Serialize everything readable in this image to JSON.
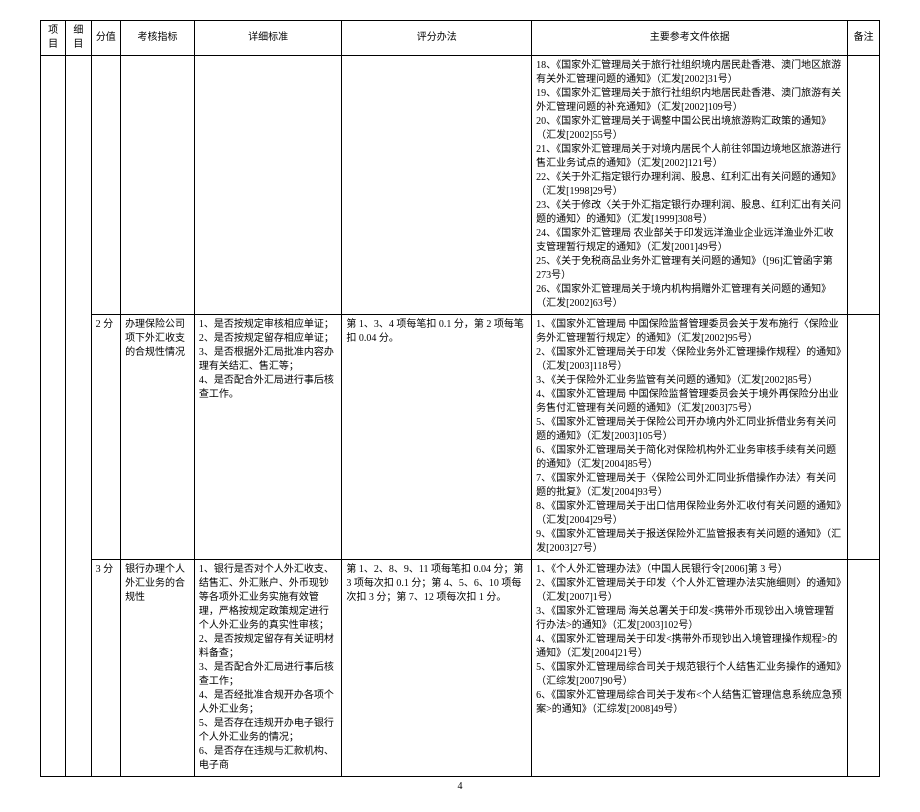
{
  "headers": {
    "project": "项目",
    "detail": "细目",
    "score": "分值",
    "index": "考核指标",
    "standard": "详细标准",
    "method": "评分办法",
    "reference": "主要参考文件依据",
    "note": "备注"
  },
  "rows": [
    {
      "score": "",
      "index": "",
      "standard": "",
      "method": "",
      "reference": "18、《国家外汇管理局关于旅行社组织境内居民赴香港、澳门地区旅游有关外汇管理问题的通知》（汇发[2002]31号）\n19、《国家外汇管理局关于旅行社组织内地居民赴香港、澳门旅游有关外汇管理问题的补充通知》（汇发[2002]109号）\n20、《国家外汇管理局关于调整中国公民出境旅游购汇政策的通知》（汇发[2002]55号）\n21、《国家外汇管理局关于对境内居民个人前往邻国边境地区旅游进行售汇业务试点的通知》（汇发[2002]121号）\n22、《关于外汇指定银行办理利润、股息、红利汇出有关问题的通知》（汇发[1998]29号）\n23、《关于修改〈关于外汇指定银行办理利润、股息、红利汇出有关问题的通知〉的通知》（汇发[1999]308号）\n24、《国家外汇管理局 农业部关于印发远洋渔业企业远洋渔业外汇收支管理暂行规定的通知》（汇发[2001]49号）\n25、《关于免税商品业务外汇管理有关问题的通知》（[96]汇管函字第273号）\n26、《国家外汇管理局关于境内机构捐赠外汇管理有关问题的通知》（汇发[2002]63号）",
      "note": ""
    },
    {
      "score": "2 分",
      "index": "办理保险公司项下外汇收支的合规性情况",
      "standard": "1、是否按规定审核相应单证；\n2、是否按规定留存相应单证；\n3、是否根据外汇局批准内容办理有关结汇、售汇等；\n4、是否配合外汇局进行事后核查工作。",
      "method": "第 1、3、4 项每笔扣 0.1 分，第 2 项每笔扣 0.04 分。",
      "reference": "1、《国家外汇管理局 中国保险监督管理委员会关于发布施行〈保险业务外汇管理暂行规定〉的通知》（汇发[2002]95号）\n2、《国家外汇管理局关于印发〈保险业务外汇管理操作规程〉的通知》（汇发[2003]118号）\n3、《关于保险外汇业务监管有关问题的通知》（汇发[2002]85号）\n4、《国家外汇管理局 中国保险监督管理委员会关于境外再保险分出业务售付汇管理有关问题的通知》（汇发[2003]75号）\n5、《国家外汇管理局关于保险公司开办境内外汇同业拆借业务有关问题的通知》（汇发[2003]105号）\n6、《国家外汇管理局关于简化对保险机构外汇业务审核手续有关问题的通知》（汇发[2004]85号）\n7、《国家外汇管理局关于〈保险公司外汇同业拆借操作办法〉有关问题的批复》（汇发[2004]93号）\n8、《国家外汇管理局关于出口信用保险业务外汇收付有关问题的通知》（汇发[2004]29号）\n9、《国家外汇管理局关于报送保险外汇监管报表有关问题的通知》（汇发[2003]27号）",
      "note": ""
    },
    {
      "score": "3 分",
      "index": "银行办理个人外汇业务的合规性",
      "standard": "1、银行是否对个人外汇收支、结售汇、外汇账户、外币现钞等各项外汇业务实施有效管理，严格按规定政策规定进行个人外汇业务的真实性审核；\n2、是否按规定留存有关证明材料备查；\n3、是否配合外汇局进行事后核查工作；\n4、是否经批准合规开办各项个人外汇业务；\n5、是否存在违规开办电子银行个人外汇业务的情况；\n6、是否存在违规与汇款机构、电子商",
      "method": "第 1、2、8、9、11 项每笔扣 0.04 分；第 3 项每次扣 0.1 分；第 4、5、6、10 项每次扣 3 分；第 7、12 项每次扣 1 分。",
      "reference": "1、《个人外汇管理办法》（中国人民银行令[2006]第 3 号）\n2、《国家外汇管理局关于印发〈个人外汇管理办法实施细则〉的通知》（汇发[2007]1号）\n3、《国家外汇管理局 海关总署关于印发<携带外币现钞出入境管理暂行办法>的通知》（汇发[2003]102号）\n4、《国家外汇管理局关于印发<携带外币现钞出入境管理操作规程>的通知》（汇发[2004]21号）\n5、《国家外汇管理局综合司关于规范银行个人结售汇业务操作的通知》（汇综发[2007]90号）\n6、《国家外汇管理局综合司关于发布<个人结售汇管理信息系统应急预案>的通知》（汇综发[2008]49号）",
      "note": ""
    }
  ],
  "page_number": "4"
}
